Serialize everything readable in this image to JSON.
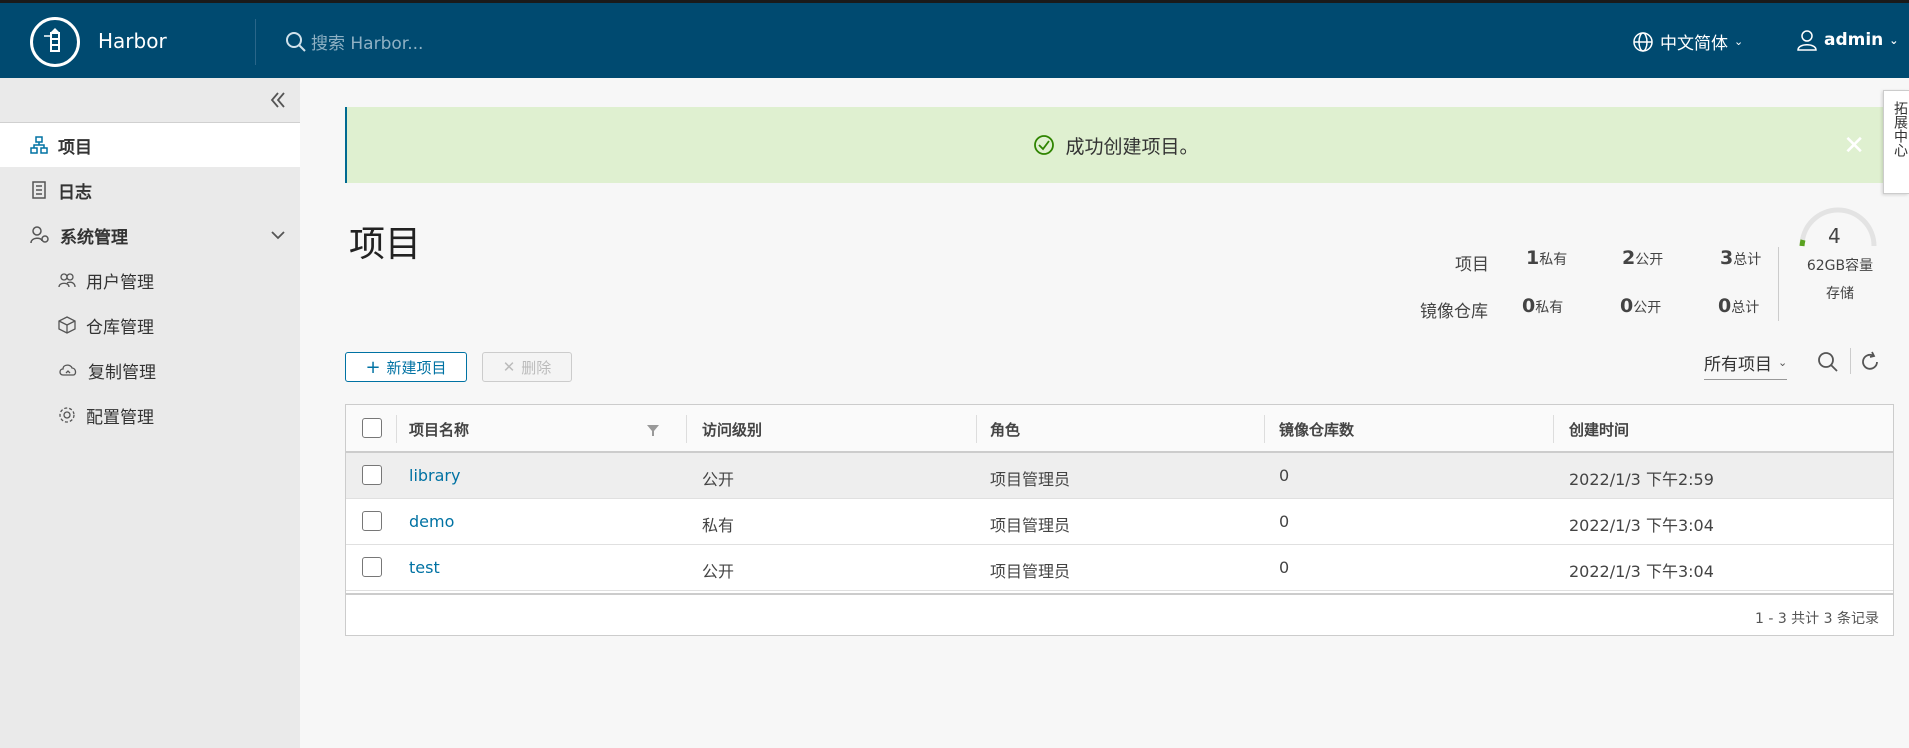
{
  "header": {
    "brand": "Harbor",
    "search_placeholder": "搜索 Harbor...",
    "language": "中文简体",
    "user": "admin"
  },
  "sidebar": {
    "items": [
      {
        "label": "项目",
        "icon": "project-icon",
        "active": true
      },
      {
        "label": "日志",
        "icon": "log-icon",
        "active": false
      },
      {
        "label": "系统管理",
        "icon": "admin-icon",
        "active": false
      }
    ],
    "sub_items": [
      {
        "label": "用户管理",
        "icon": "users-icon"
      },
      {
        "label": "仓库管理",
        "icon": "registry-icon"
      },
      {
        "label": "复制管理",
        "icon": "replication-icon"
      },
      {
        "label": "配置管理",
        "icon": "config-icon"
      }
    ]
  },
  "alert": {
    "message": "成功创建项目。",
    "color": "#dff0d0"
  },
  "side_tab": {
    "label": "拓展中心"
  },
  "page": {
    "title": "项目"
  },
  "summary": {
    "project_label": "项目",
    "repo_label": "镜像仓库",
    "project": {
      "private": "1",
      "public": "2",
      "total": "3"
    },
    "repo": {
      "private": "0",
      "public": "0",
      "total": "0"
    },
    "private_unit": "私有",
    "public_unit": "公开",
    "total_unit": "总计",
    "storage_count": "4",
    "storage_capacity": "62GB容量",
    "storage_label": "存储"
  },
  "toolbar": {
    "new_label": "新建项目",
    "delete_label": "删除",
    "filter_value": "所有项目"
  },
  "table": {
    "columns": [
      "项目名称",
      "访问级别",
      "角色",
      "镜像仓库数",
      "创建时间"
    ],
    "rows": [
      {
        "name": "library",
        "access": "公开",
        "role": "项目管理员",
        "repos": "0",
        "created": "2022/1/3 下午2:59"
      },
      {
        "name": "demo",
        "access": "私有",
        "role": "项目管理员",
        "repos": "0",
        "created": "2022/1/3 下午3:04"
      },
      {
        "name": "test",
        "access": "公开",
        "role": "项目管理员",
        "repos": "0",
        "created": "2022/1/3 下午3:04"
      }
    ],
    "pagination": "1 - 3 共计 3 条记录"
  },
  "colors": {
    "header_bg": "#004a70",
    "accent": "#0072a3",
    "success_bg": "#dff0d0",
    "success_icon": "#2f8400"
  }
}
